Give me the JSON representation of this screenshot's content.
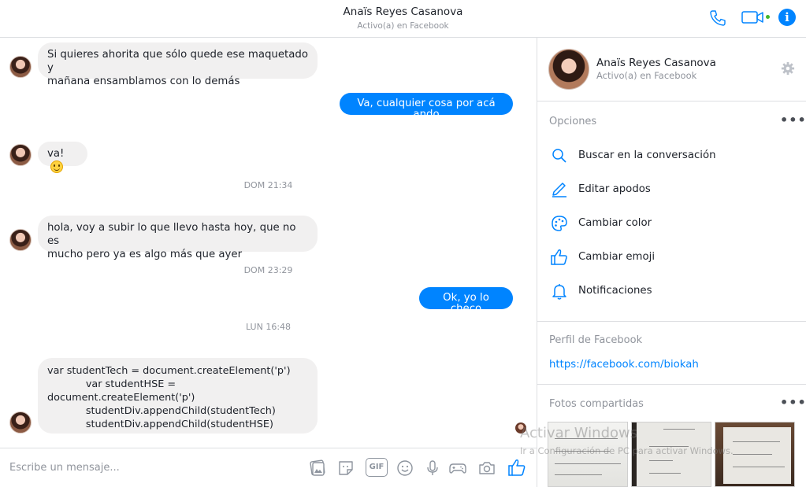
{
  "header": {
    "contact_name": "Anaïs Reyes Casanova",
    "status": "Activo(a) en Facebook",
    "info_glyph": "i"
  },
  "conversation": {
    "messages": [
      {
        "from": "contact",
        "text": "Si quieres ahorita que sólo quede ese maquetado y\nmañana ensamblamos con lo demás"
      },
      {
        "from": "me",
        "text": "Va, cualquier cosa por acá ando"
      },
      {
        "from": "contact",
        "text": "va!",
        "emoji": "smiley-emoji"
      },
      {
        "type": "timestamp",
        "text": "DOM 21:34"
      },
      {
        "from": "contact",
        "text": "hola, voy a subir lo que llevo hasta hoy, que no es\nmucho pero ya es algo más que ayer"
      },
      {
        "type": "timestamp",
        "text": "DOM 23:29"
      },
      {
        "from": "me",
        "text": "Ok, yo lo checo"
      },
      {
        "type": "timestamp",
        "text": "LUN 16:48"
      },
      {
        "from": "contact",
        "text": "var studentTech = document.createElement('p')\n            var studentHSE =\ndocument.createElement('p')\n            studentDiv.appendChild(studentTech)\n            studentDiv.appendChild(studentHSE)"
      }
    ]
  },
  "composer": {
    "placeholder": "Escribe un mensaje...",
    "icons": [
      "image-icon",
      "sticker-icon",
      "gif-icon",
      "emoji-icon",
      "microphone-icon",
      "game-icon",
      "camera-icon",
      "like-icon"
    ],
    "gif_label": "GIF"
  },
  "sidebar": {
    "profile": {
      "name": "Anaïs Reyes Casanova",
      "status": "Activo(a) en Facebook"
    },
    "options_title": "Opciones",
    "more_label": "•••",
    "options": [
      {
        "label": "Buscar en la conversación",
        "icon": "search-icon"
      },
      {
        "label": "Editar apodos",
        "icon": "pencil-icon"
      },
      {
        "label": "Cambiar color",
        "icon": "palette-icon"
      },
      {
        "label": "Cambiar emoji",
        "icon": "thumbs-up-icon"
      },
      {
        "label": "Notificaciones",
        "icon": "bell-icon"
      }
    ],
    "facebook_profile_title": "Perfil de Facebook",
    "facebook_link": "https://facebook.com/biokah",
    "shared_photos_title": "Fotos compartidas"
  },
  "watermark": {
    "title": "Activar Windows",
    "subtitle": "Ir a Configuración de PC para activar Windows."
  },
  "colors": {
    "accent": "#0084ff",
    "incoming_bubble": "#f1f0f0",
    "muted_text": "#90949c",
    "divider": "#dddfe2",
    "online": "#42b72a"
  }
}
